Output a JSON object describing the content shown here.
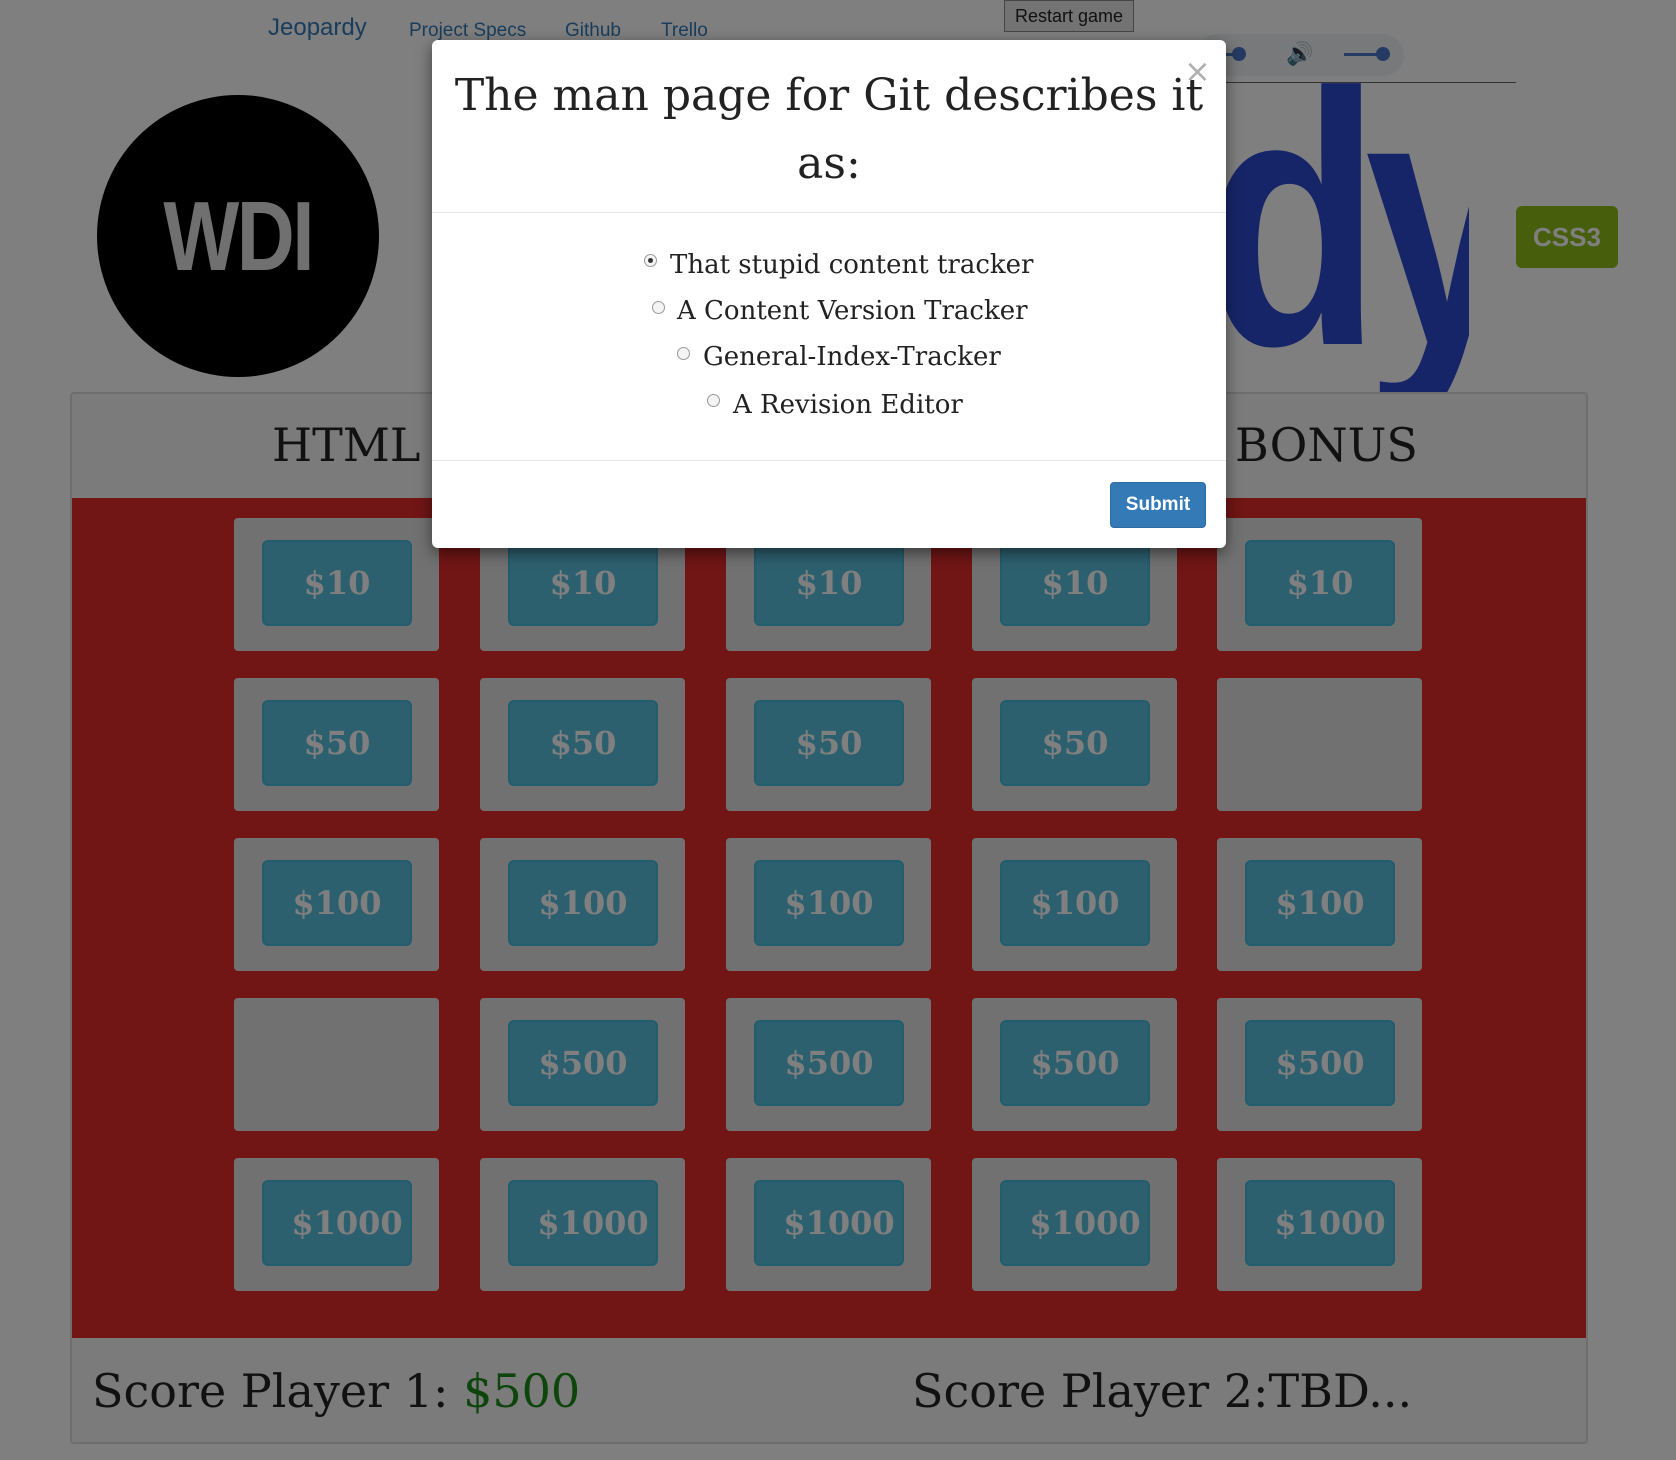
{
  "nav": {
    "brand": "Jeopardy",
    "links": [
      "Project Specs",
      "Github",
      "Trello"
    ],
    "restart_label": "Restart game"
  },
  "logo": {
    "text": "WDI"
  },
  "title_fragment": "dy!",
  "badge": "CSS3",
  "categories": [
    "HTML",
    "BONUS"
  ],
  "board": {
    "rows": [
      [
        "$10",
        "$10",
        "$10",
        "$10",
        "$10"
      ],
      [
        "$50",
        "$50",
        "$50",
        "$50",
        ""
      ],
      [
        "$100",
        "$100",
        "$100",
        "$100",
        "$100"
      ],
      [
        "",
        "$500",
        "$500",
        "$500",
        "$500"
      ],
      [
        "$1000",
        "$1000",
        "$1000",
        "$1000",
        "$1000"
      ]
    ]
  },
  "scores": {
    "p1_label": "Score Player 1:",
    "p1_value": "$500",
    "p2_label": "Score Player 2:TBD..."
  },
  "modal": {
    "question": "The man page for Git describes it as:",
    "close_glyph": "×",
    "options": [
      "That stupid content tracker",
      "A Content Version Tracker",
      "General-Index-Tracker",
      "A Revision Editor"
    ],
    "selected_option": "That stupid content tracker",
    "submit_label": "Submit"
  },
  "colors": {
    "board_bg": "#e22a2a",
    "chip_bg": "#5bc0de",
    "title_blue": "#2d4bd1",
    "badge_green": "#8fbf1a",
    "submit_blue": "#337ab7",
    "score_green": "#1a8a1a"
  },
  "icons": [
    "speaker-icon",
    "close-icon"
  ]
}
